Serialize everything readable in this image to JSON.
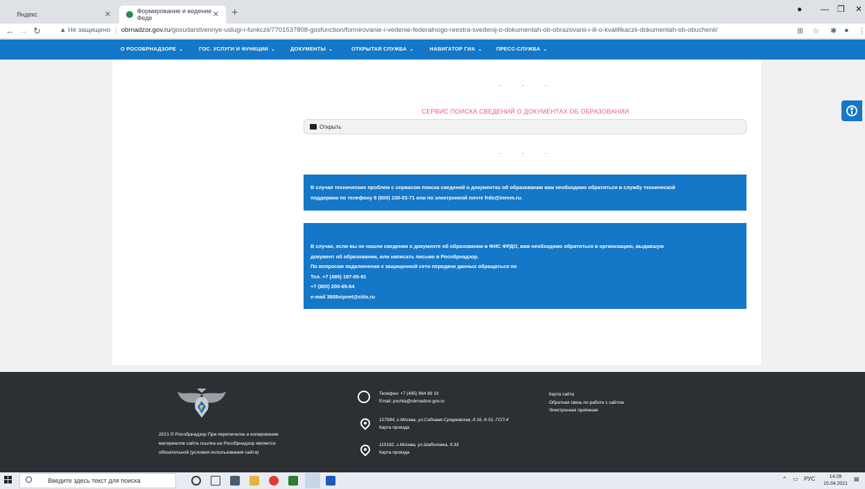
{
  "browser": {
    "tabs": [
      {
        "title": "Яндекс",
        "active": false
      },
      {
        "title": "Формирование и ведение Феде",
        "active": true
      }
    ],
    "security_label": "Не защищено",
    "url_domain": "obrnadzor.gov.ru",
    "url_path": "/gosudarstvennye-uslugi-i-funkczii/7701537808-gosfunction/formirovanie-i-vedenie-federalnogo-reestra-svedenij-o-dokumentah-ob-obrazovanii-i-ili-o-kvalifikaczii-dokumentah-ob-obuchenii/"
  },
  "site_nav": {
    "items": [
      {
        "label": "О РОСОБРНАДЗОРЕ"
      },
      {
        "label": "ГОС. УСЛУГИ И ФУНКЦИИ"
      },
      {
        "label": "ДОКУМЕНТЫ"
      },
      {
        "label": "ОТКРЫТАЯ СЛУЖБА"
      },
      {
        "label": "НАВИГАТОР ГИА"
      },
      {
        "label": "ПРЕСС-СЛУЖБА"
      }
    ]
  },
  "main": {
    "service_title": "СЕРВИС ПОИСКА СВЕДЕНИЙ О ДОКУМЕНТАХ ОБ ОБРАЗОВАНИИ",
    "open_label": "Открыть",
    "info1": {
      "lines": [
        "В случае технических проблем с сервисом поиска сведений о документах об образовании вам необходимо обратиться в службу технической",
        "поддержки по телефону  8 (800) 100-03-71 или по электронной почте frdo@inevm.ru."
      ]
    },
    "info2": {
      "lines": [
        "В случае, если вы не нашли сведения о документе об образовании в ФИС ФРДО, вам необходимо обратиться в организацию, выдавшую",
        "документ об образовании, или написать письмо в Рособрнадзор.",
        "По вопросам подключения к защищенной сети передачи данных обращаться по",
        "Тел. +7 (495) 197-65-91",
        "+7 (800) 200-65-64",
        "e-mail 3608vipnet@citis.ru"
      ]
    }
  },
  "footer": {
    "copyright_lines": [
      "2021 © Рособрнадзор При перепечатке и копировании",
      "материалов сайта ссылка на Рособрнадзор является",
      "обязательной (условия использования сайта)"
    ],
    "phone": "Телефон: +7 (495) 984 89 19",
    "email": "Email: pochta@obrnadzor.gov.ru",
    "address1": "127994, г.Москва, ул.Садовая-Сухаревская, д.16, К-51, ГСП-4",
    "map1": "Карта проезда",
    "address2": "115162, г.Москва, ул.Шаболовка, д.33",
    "map2": "Карта проезда",
    "links": [
      "Карта сайта",
      "Обратная связь по работе с сайтом",
      "Электронная приёмная"
    ]
  },
  "taskbar": {
    "search_placeholder": "Введите здесь текст для поиска",
    "lang": "РУС",
    "time": "14:28",
    "date": "15.04.2021"
  }
}
